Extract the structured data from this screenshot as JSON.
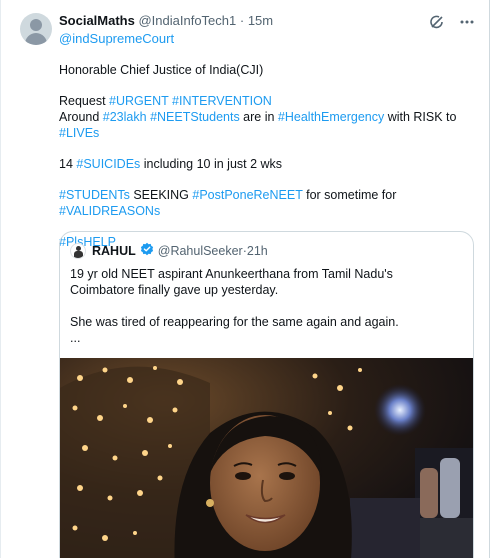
{
  "tweet": {
    "author_name": "SocialMaths",
    "author_handle": "@IndiaInfoTech1",
    "separator": " · ",
    "time": "15m",
    "reply_to": "@indSupremeCourt",
    "icons": [
      "grok-icon",
      "more-icon"
    ],
    "line1": "Honorable Chief Justice of India(CJI)",
    "line2_prefix": "Request ",
    "line2_tag1": "#URGENT",
    "line2_space": " ",
    "line2_tag2": "#INTERVENTION",
    "line3_prefix": "Around ",
    "line3_tag1": "#23lakh",
    "line3_space": " ",
    "line3_tag2": "#NEETStudents",
    "line3_mid": " are in ",
    "line3_tag3": "#HealthEmergency",
    "line3_mid2": " with RISK to ",
    "line3_tag4": "#LIVEs",
    "line4_prefix": "14 ",
    "line4_tag": "#SUICIDEs",
    "line4_suffix": " including 10 in just 2 wks",
    "line5_tag1": "#STUDENTs",
    "line5_mid": " SEEKING ",
    "line5_tag2": "#PostPoneReNEET",
    "line5_mid2": " for sometime for ",
    "line5_tag3": "#VALIDREASONs",
    "line6_tag": "#PlsHELP"
  },
  "quote": {
    "author_name": "RAHUL",
    "author_handle": "@RahulSeeker",
    "separator": " · ",
    "time": "21h",
    "text_line1": "19 yr old NEET aspirant Anunkeerthana from Tamil Nadu's Coimbatore finally gave up yesterday.",
    "text_line2": "She was tired of reappearing for the same again and again.",
    "ellipsis": "...",
    "verified_color": "#1d9bf0"
  },
  "colors": {
    "link": "#1d9bf0",
    "secondary": "#536471",
    "border": "#cfd9de"
  }
}
